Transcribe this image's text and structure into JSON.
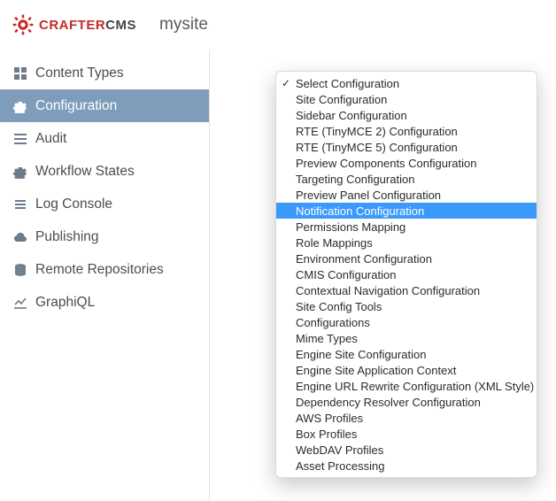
{
  "header": {
    "logo_prefix": "CRAFTER",
    "logo_suffix": "CMS",
    "site_name": "mysite"
  },
  "sidebar": {
    "items": [
      {
        "label": "Content Types"
      },
      {
        "label": "Configuration"
      },
      {
        "label": "Audit"
      },
      {
        "label": "Workflow States"
      },
      {
        "label": "Log Console"
      },
      {
        "label": "Publishing"
      },
      {
        "label": "Remote Repositories"
      },
      {
        "label": "GraphiQL"
      }
    ]
  },
  "dropdown": {
    "items": [
      "Select Configuration",
      "Site Configuration",
      "Sidebar Configuration",
      "RTE (TinyMCE 2) Configuration",
      "RTE (TinyMCE 5) Configuration",
      "Preview Components Configuration",
      "Targeting Configuration",
      "Preview Panel Configuration",
      "Notification Configuration",
      "Permissions Mapping",
      "Role Mappings",
      "Environment Configuration",
      "CMIS Configuration",
      "Contextual Navigation Configuration",
      "Site Config Tools",
      "Configurations",
      "Mime Types",
      "Engine Site Configuration",
      "Engine Site Application Context",
      "Engine URL Rewrite Configuration (XML Style)",
      "Dependency Resolver Configuration",
      "AWS Profiles",
      "Box Profiles",
      "WebDAV Profiles",
      "Asset Processing"
    ],
    "selected_index": 0,
    "highlight_index": 8
  }
}
